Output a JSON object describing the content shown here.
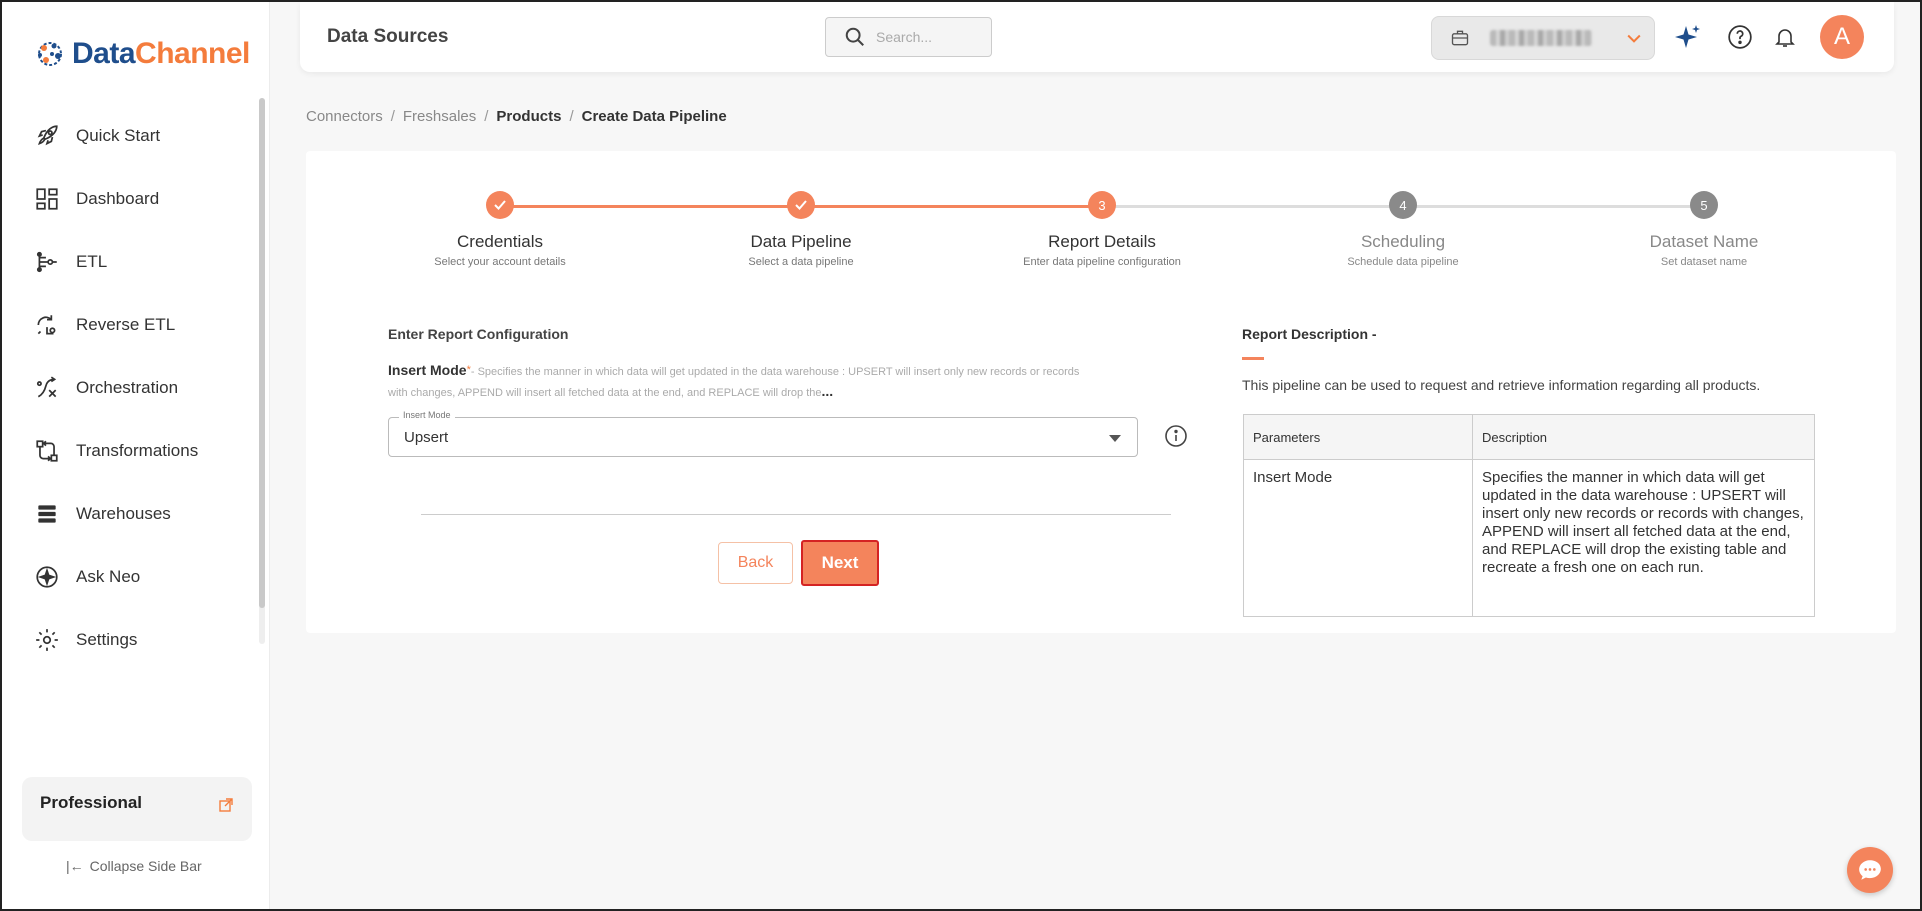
{
  "app": {
    "logo_part1": "Data",
    "logo_part2": "Channel"
  },
  "sidebar": {
    "items": [
      {
        "label": "Quick Start",
        "icon": "rocket-icon"
      },
      {
        "label": "Dashboard",
        "icon": "dashboard-icon"
      },
      {
        "label": "ETL",
        "icon": "etl-icon"
      },
      {
        "label": "Reverse ETL",
        "icon": "reverse-etl-icon"
      },
      {
        "label": "Orchestration",
        "icon": "orchestration-icon"
      },
      {
        "label": "Transformations",
        "icon": "transformations-icon"
      },
      {
        "label": "Warehouses",
        "icon": "warehouses-icon"
      },
      {
        "label": "Ask Neo",
        "icon": "ask-neo-icon"
      },
      {
        "label": "Settings",
        "icon": "gear-icon"
      }
    ],
    "plan_name": "Professional",
    "collapse_label": "Collapse Side Bar"
  },
  "header": {
    "title": "Data Sources",
    "search_placeholder": "Search...",
    "avatar_letter": "A"
  },
  "breadcrumb": {
    "items": [
      "Connectors",
      "Freshsales",
      "Products",
      "Create Data Pipeline"
    ],
    "separator": "/"
  },
  "stepper": {
    "steps": [
      {
        "number": "1",
        "title": "Credentials",
        "subtitle": "Select your account details",
        "state": "done"
      },
      {
        "number": "2",
        "title": "Data Pipeline",
        "subtitle": "Select a data pipeline",
        "state": "done"
      },
      {
        "number": "3",
        "title": "Report Details",
        "subtitle": "Enter data pipeline configuration",
        "state": "active"
      },
      {
        "number": "4",
        "title": "Scheduling",
        "subtitle": "Schedule data pipeline",
        "state": "pending"
      },
      {
        "number": "5",
        "title": "Dataset Name",
        "subtitle": "Set dataset name",
        "state": "pending"
      }
    ]
  },
  "form": {
    "section_title": "Enter Report Configuration",
    "field_label": "Insert Mode",
    "required_mark": "*",
    "field_hint": "- Specifies the manner in which data will get updated in the data warehouse : UPSERT will insert only new records or records with changes, APPEND will insert all fetched data at the end, and REPLACE will drop the",
    "field_hint_more": "...",
    "select_legend": "Insert Mode",
    "select_value": "Upsert",
    "back_label": "Back",
    "next_label": "Next"
  },
  "report_description": {
    "title": "Report Description -",
    "text": "This pipeline can be used to request and retrieve information regarding all products.",
    "columns": [
      "Parameters",
      "Description"
    ],
    "rows": [
      {
        "parameter": "Insert Mode",
        "description": "Specifies the manner in which data will get updated in the data warehouse : UPSERT will insert only new records or records with changes, APPEND will insert all fetched data at the end, and REPLACE will drop the existing table and recreate a fresh one on each run."
      }
    ]
  },
  "colors": {
    "accent": "#f4845c",
    "brand_blue": "#1f4e8c",
    "pending_step": "#8a8a8a"
  }
}
